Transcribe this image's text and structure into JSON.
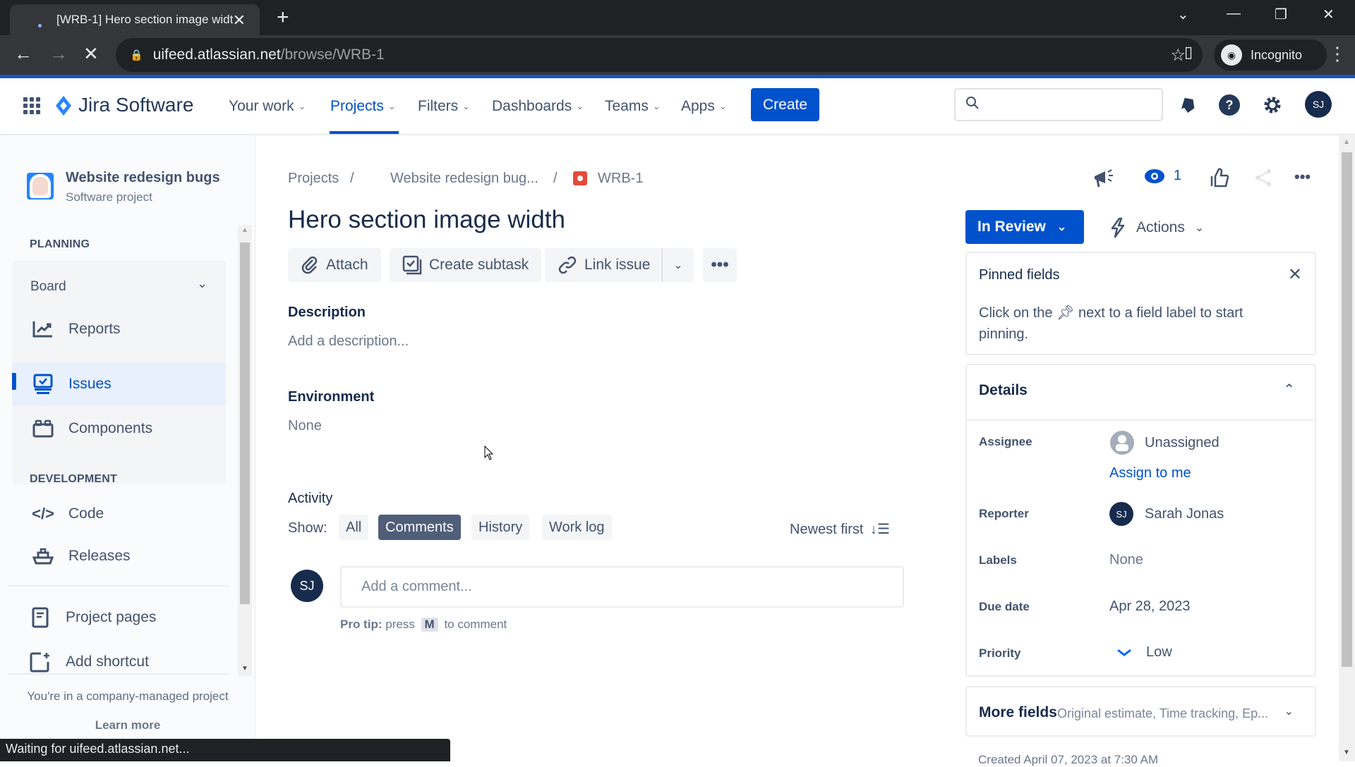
{
  "browser": {
    "tab_title": "[WRB-1] Hero section image widt",
    "url_host": "uifeed.atlassian.net",
    "url_path": "/browse/WRB-1",
    "profile_label": "Incognito",
    "status_text": "Waiting for uifeed.atlassian.net..."
  },
  "topnav": {
    "product": "Jira Software",
    "items": [
      {
        "label": "Your work",
        "active": false
      },
      {
        "label": "Projects",
        "active": true
      },
      {
        "label": "Filters",
        "active": false
      },
      {
        "label": "Dashboards",
        "active": false
      },
      {
        "label": "Teams",
        "active": false
      },
      {
        "label": "Apps",
        "active": false
      }
    ],
    "create_label": "Create",
    "search_placeholder": "",
    "user_initials": "SJ"
  },
  "sidebar": {
    "project_name": "Website redesign bugs",
    "project_type": "Software project",
    "planning_heading": "PLANNING",
    "board_label": "Board",
    "items": [
      {
        "label": "Reports",
        "icon": "chart-line-icon"
      },
      {
        "label": "Issues",
        "icon": "issues-icon",
        "active": true
      },
      {
        "label": "Components",
        "icon": "components-icon"
      }
    ],
    "development_heading": "DEVELOPMENT",
    "dev_items": [
      {
        "label": "Code",
        "icon": "code-icon"
      },
      {
        "label": "Releases",
        "icon": "ship-icon"
      }
    ],
    "extra_items": [
      {
        "label": "Project pages",
        "icon": "page-icon"
      },
      {
        "label": "Add shortcut",
        "icon": "add-shortcut-icon"
      }
    ],
    "footer_text": "You're in a company-managed project",
    "learn_more": "Learn more"
  },
  "issue": {
    "breadcrumb": [
      "Projects",
      "Website redesign bug...",
      "WRB-1"
    ],
    "key": "WRB-1",
    "title": "Hero section image width",
    "toolbar": {
      "attach": "Attach",
      "create_subtask": "Create subtask",
      "link_issue": "Link issue"
    },
    "description_label": "Description",
    "description_placeholder": "Add a description...",
    "environment_label": "Environment",
    "environment_value": "None",
    "activity": {
      "label": "Activity",
      "show_label": "Show:",
      "filters": [
        {
          "label": "All",
          "active": false
        },
        {
          "label": "Comments",
          "active": true
        },
        {
          "label": "History",
          "active": false
        },
        {
          "label": "Work log",
          "active": false
        }
      ],
      "sort_label": "Newest first",
      "comment_placeholder": "Add a comment...",
      "commenter_initials": "SJ",
      "pro_tip_prefix": "Pro tip:",
      "pro_tip_press": "press",
      "pro_tip_key": "M",
      "pro_tip_suffix": "to comment"
    }
  },
  "right_panel": {
    "watch_count": "1",
    "status": "In Review",
    "actions_label": "Actions",
    "pinned": {
      "title": "Pinned fields",
      "text_before": "Click on the",
      "text_after": "next to a field label to start pinning."
    },
    "details": {
      "title": "Details",
      "fields": [
        {
          "label": "Assignee",
          "value": "Unassigned",
          "link": "Assign to me"
        },
        {
          "label": "Reporter",
          "value": "Sarah Jonas",
          "initials": "SJ"
        },
        {
          "label": "Labels",
          "value": "None"
        },
        {
          "label": "Due date",
          "value": "Apr 28, 2023"
        },
        {
          "label": "Priority",
          "value": "Low"
        }
      ]
    },
    "more_fields": {
      "title": "More fields",
      "summary": "Original estimate, Time tracking, Ep..."
    },
    "created_partial": "Created April 07, 2023 at 7:30 AM"
  },
  "colors": {
    "brand": "#0052cc",
    "bug": "#e5493a",
    "text": "#172b4d"
  }
}
